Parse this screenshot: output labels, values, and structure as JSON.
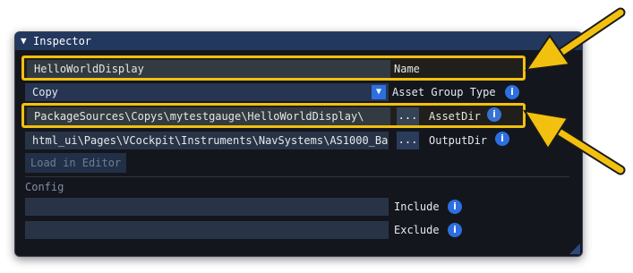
{
  "window": {
    "title": "Inspector"
  },
  "fields": {
    "name": {
      "value": "HelloWorldDisplay",
      "label": "Name"
    },
    "asset_group_type": {
      "value": "Copy",
      "label": "Asset Group Type"
    },
    "asset_dir": {
      "value": "PackageSources\\Copys\\mytestgauge\\HelloWorldDisplay\\",
      "label": "AssetDir",
      "browse_label": "..."
    },
    "output_dir": {
      "value": "html_ui\\Pages\\VCockpit\\Instruments\\NavSystems\\AS1000_Ba",
      "label": "OutputDir",
      "browse_label": "..."
    }
  },
  "buttons": {
    "load_in_editor": "Load in Editor"
  },
  "config": {
    "section_label": "Config",
    "include": {
      "value": "",
      "label": "Include"
    },
    "exclude": {
      "value": "",
      "label": "Exclude"
    }
  },
  "icons": {
    "info_glyph": "i",
    "collapse_glyph": "▼",
    "dropdown_glyph": "▼"
  },
  "colors": {
    "highlight": "#f2c00f",
    "accent": "#2d6fe0",
    "titlebar": "#23385f"
  }
}
